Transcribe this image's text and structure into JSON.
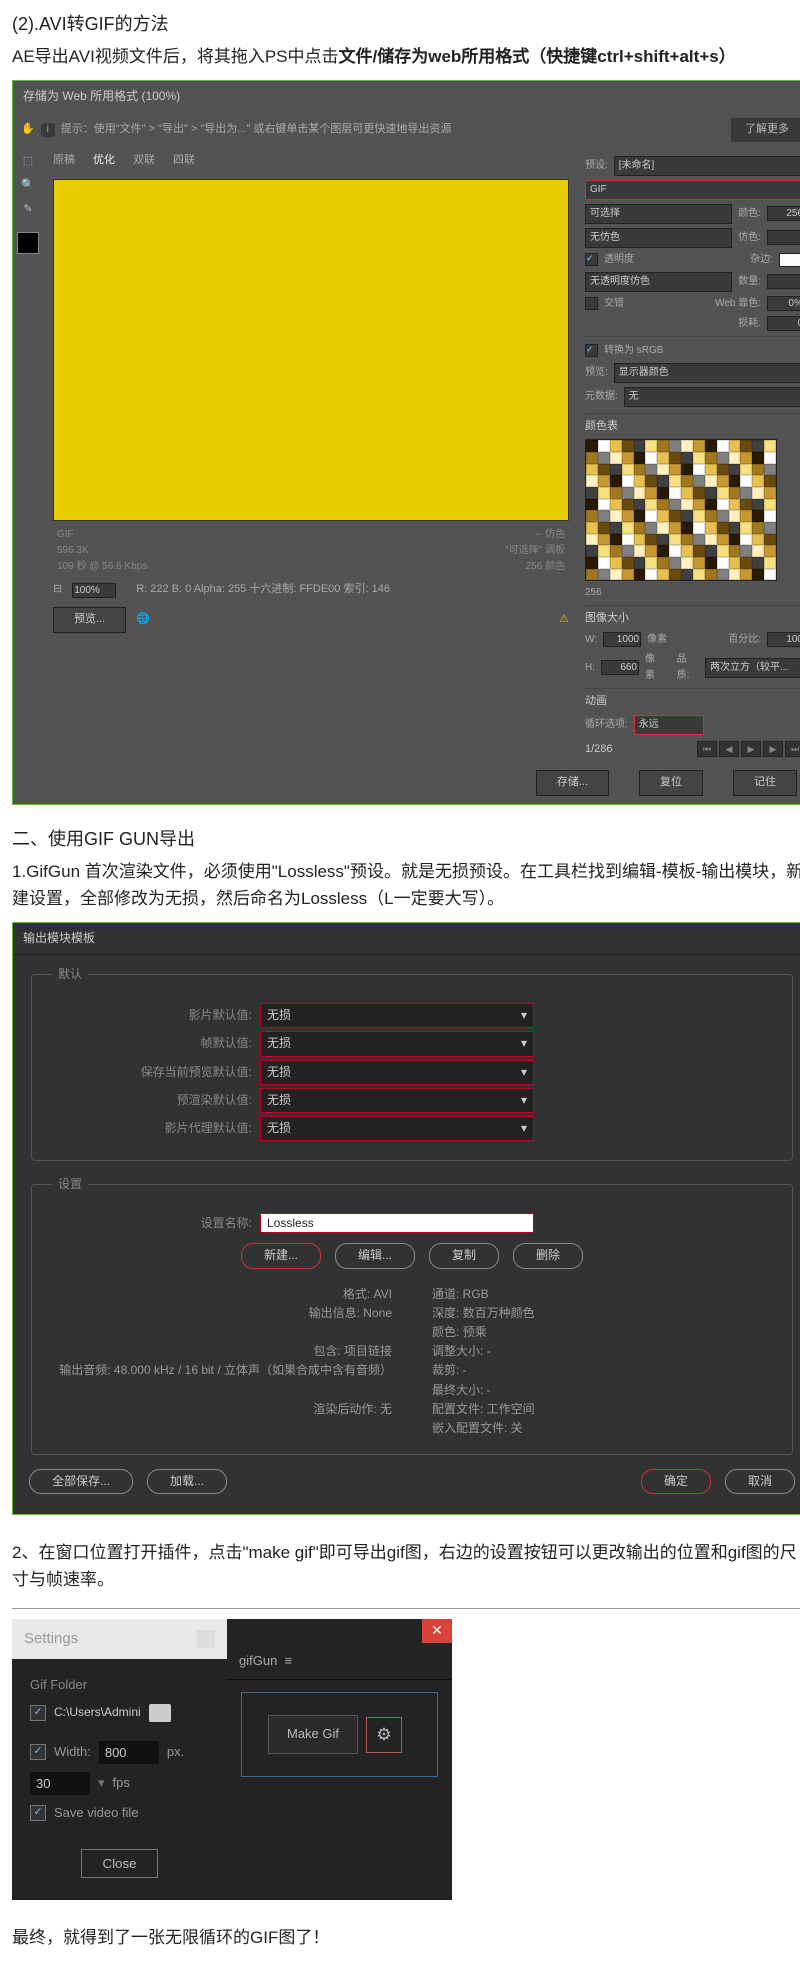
{
  "intro": {
    "title": "(2).AVI转GIF的方法",
    "line_a": "AE导出AVI视频文件后，将其拖入PS中点击",
    "line_b_bold": "文件/储存为web所用格式（快捷键ctrl+shift+alt+s）"
  },
  "ps": {
    "window_title": "存储为 Web 所用格式 (100%)",
    "tip": "提示：使用\"文件\" > \"导出\" > \"导出为...\" 或右键单击某个图层可更快速地导出资源",
    "tip_more": "了解更多",
    "tabs": [
      "原稿",
      "优化",
      "双联",
      "四联"
    ],
    "info_left_1": "GIF",
    "info_left_2": "596.3K",
    "info_left_3": "109 秒 @ 56.6 Kbps",
    "info_right_1": "-- 仿色",
    "info_right_2": "\"可选择\" 调板",
    "info_right_3": "256 颜色",
    "zoom": "100%",
    "status": "R: 222   B: 0        Alpha: 255   十六进制: FFDE00   索引: 146",
    "preview_btn": "预览...",
    "preset_label": "预设:",
    "preset_value": "[未命名]",
    "format": "GIF",
    "algo": "可选择",
    "colors_label": "颜色:",
    "colors": "256",
    "dither": "无仿色",
    "dither_label": "仿色:",
    "transparency": "透明度",
    "matte_label": "杂边:",
    "trans_dither": "无透明度仿色",
    "amount_label": "数量:",
    "interlace": "交错",
    "web_label": "Web 靠色:",
    "web_val": "0%",
    "loss_label": "损耗:",
    "loss_val": "0",
    "srgb": "转换为 sRGB",
    "preview_label": "预览:",
    "preview_val": "显示器颜色",
    "meta_label": "元数据:",
    "meta_val": "无",
    "table_title": "颜色表",
    "table_count": "256",
    "size_title": "图像大小",
    "w_label": "W:",
    "w": "1000",
    "px": "像素",
    "h_label": "H:",
    "h": "660",
    "pct_label": "百分比:",
    "pct": "100",
    "quality_label": "品质:",
    "quality": "两次立方（较平...",
    "anim_title": "动画",
    "loop_label": "循环选项:",
    "loop": "永远",
    "frame": "1/286",
    "btn_save": "存储...",
    "btn_reset": "复位",
    "btn_remember": "记住"
  },
  "s2": {
    "h": "二、使用GIF GUN导出",
    "p": "1.GifGun 首次渲染文件，必须使用\"Lossless\"预设。就是无损预设。在工具栏找到编辑-模板-输出模块，新建设置，全部修改为无损，然后命名为Lossless（L一定要大写）。"
  },
  "om": {
    "title": "输出模块模板",
    "legend1": "默认",
    "rows": [
      {
        "l": "影片默认值:",
        "v": "无损"
      },
      {
        "l": "帧默认值:",
        "v": "无损"
      },
      {
        "l": "保存当前预览默认值:",
        "v": "无损"
      },
      {
        "l": "预渲染默认值:",
        "v": "无损"
      },
      {
        "l": "影片代理默认值:",
        "v": "无损"
      }
    ],
    "legend2": "设置",
    "name_label": "设置名称:",
    "name": "Lossless",
    "btns": [
      "新建...",
      "编辑...",
      "复制",
      "删除"
    ],
    "left": [
      "格式: AVI",
      "输出信息: None",
      "",
      "包含: 项目链接",
      "输出音频: 48.000 kHz / 16 bit / 立体声（如果合成中含有音频）",
      "",
      "渲染后动作: 无"
    ],
    "right": [
      "通道: RGB",
      "深度: 数百万种颜色",
      "颜色: 预乘",
      "调整大小: -",
      "裁剪: -",
      "最终大小: -",
      "配置文件: 工作空间",
      "嵌入配置文件: 关"
    ],
    "save_all": "全部保存...",
    "load": "加载...",
    "ok": "确定",
    "cancel": "取消"
  },
  "s3": {
    "p": "2、在窗口位置打开插件，点击\"make gif\"即可导出gif图，右边的设置按钮可以更改输出的位置和gif图的尺寸与帧速率。"
  },
  "gg": {
    "settings": "Settings",
    "folder_label": "Gif Folder",
    "path": "C:\\Users\\Admini",
    "width_label": "Width:",
    "width": "800",
    "px": "px.",
    "fps": "30",
    "fps_label": "fps",
    "save_video": "Save video file",
    "close": "Close",
    "panel": "gifGun",
    "hamburger": "≡",
    "make": "Make Gif"
  },
  "final": "最终，就得到了一张无限循环的GIF图了！"
}
